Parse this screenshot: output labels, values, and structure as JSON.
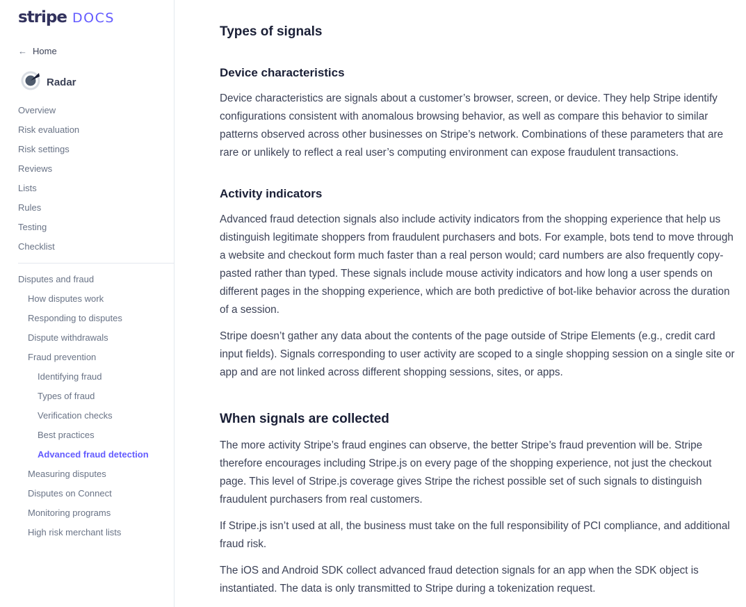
{
  "logo": {
    "wordmark": "stripe",
    "docs": "DOCS"
  },
  "sidebar": {
    "home_label": "Home",
    "product_label": "Radar",
    "items": [
      {
        "label": "Overview",
        "level": 0
      },
      {
        "label": "Risk evaluation",
        "level": 0
      },
      {
        "label": "Risk settings",
        "level": 0
      },
      {
        "label": "Reviews",
        "level": 0
      },
      {
        "label": "Lists",
        "level": 0
      },
      {
        "label": "Rules",
        "level": 0
      },
      {
        "label": "Testing",
        "level": 0
      },
      {
        "label": "Checklist",
        "level": 0
      }
    ],
    "items2": [
      {
        "label": "Disputes and fraud",
        "level": 0
      },
      {
        "label": "How disputes work",
        "level": 1
      },
      {
        "label": "Responding to disputes",
        "level": 1
      },
      {
        "label": "Dispute withdrawals",
        "level": 1
      },
      {
        "label": "Fraud prevention",
        "level": 1
      },
      {
        "label": "Identifying fraud",
        "level": 2
      },
      {
        "label": "Types of fraud",
        "level": 2
      },
      {
        "label": "Verification checks",
        "level": 2
      },
      {
        "label": "Best practices",
        "level": 2
      },
      {
        "label": "Advanced fraud detection",
        "level": 2,
        "active": true
      },
      {
        "label": "Measuring disputes",
        "level": 1
      },
      {
        "label": "Disputes on Connect",
        "level": 1
      },
      {
        "label": "Monitoring programs",
        "level": 1
      },
      {
        "label": "High risk merchant lists",
        "level": 1
      }
    ]
  },
  "main": {
    "section_title": "Types of signals",
    "device_heading": "Device characteristics",
    "device_p1": "Device characteristics are signals about a customer’s browser, screen, or device. They help Stripe identify configurations consistent with anomalous browsing behavior, as well as compare this behavior to similar patterns observed across other businesses on Stripe’s network. Combinations of these parameters that are rare or unlikely to reflect a real user’s computing environment can expose fraudulent transactions.",
    "activity_heading": "Activity indicators",
    "activity_p1": "Advanced fraud detection signals also include activity indicators from the shopping experience that help us distinguish legitimate shoppers from fraudulent purchasers and bots. For example, bots tend to move through a website and checkout form much faster than a real person would; card numbers are also frequently copy-pasted rather than typed. These signals include mouse activity indicators and how long a user spends on different pages in the shopping experience, which are both predictive of bot-like behavior across the duration of a session.",
    "activity_p2": "Stripe doesn’t gather any data about the contents of the page outside of Stripe Elements (e.g., credit card input fields). Signals corresponding to user activity are scoped to a single shopping session on a single site or app and are not linked across different shopping sessions, sites, or apps.",
    "when_title": "When signals are collected",
    "when_p1": "The more activity Stripe’s fraud engines can observe, the better Stripe’s fraud prevention will be. Stripe therefore encourages including Stripe.js on every page of the shopping experience, not just the checkout page. This level of Stripe.js coverage gives Stripe the richest possible set of such signals to distinguish fraudulent purchasers from real customers.",
    "when_p2": "If Stripe.js isn’t used at all, the business must take on the full responsibility of PCI compliance, and additional fraud risk.",
    "when_p3": "The iOS and Android SDK collect advanced fraud detection signals for an app when the SDK object is instantiated. The data is only transmitted to Stripe during a tokenization request."
  }
}
